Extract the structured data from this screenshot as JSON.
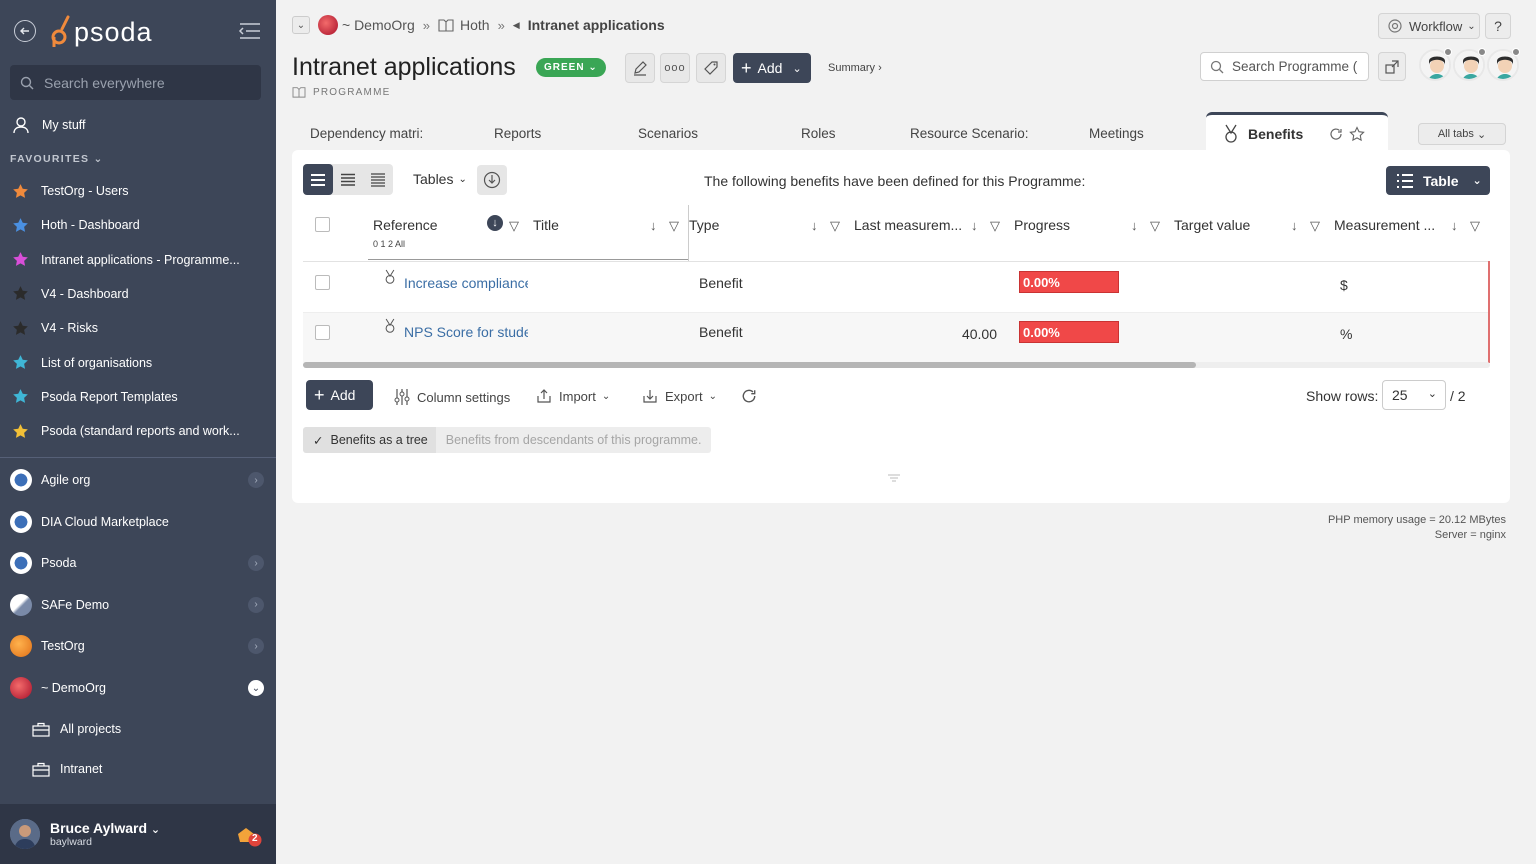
{
  "sidebar": {
    "logo": "psoda",
    "search_placeholder": "Search everywhere",
    "mystuff": "My stuff",
    "favourites_label": "FAVOURITES",
    "favourites": [
      {
        "label": "TestOrg - Users",
        "color": "#f08a3c"
      },
      {
        "label": "Hoth - Dashboard",
        "color": "#4a90e2"
      },
      {
        "label": "Intranet applications - Programme...",
        "color": "#d94fd9"
      },
      {
        "label": "V4 - Dashboard",
        "color": "#2b2b2b"
      },
      {
        "label": "V4 - Risks",
        "color": "#2b2b2b"
      },
      {
        "label": "List of organisations",
        "color": "#3fb6d6"
      },
      {
        "label": "Psoda Report Templates",
        "color": "#3fb6d6"
      },
      {
        "label": "Psoda (standard reports and work...",
        "color": "#f2c037"
      }
    ],
    "orgs": [
      {
        "label": "Agile org",
        "has_chevron": true
      },
      {
        "label": "DIA Cloud Marketplace",
        "has_chevron": false
      },
      {
        "label": "Psoda",
        "has_chevron": true
      },
      {
        "label": "SAFe Demo",
        "has_chevron": true
      },
      {
        "label": "TestOrg",
        "has_chevron": true
      },
      {
        "label": "~ DemoOrg",
        "has_chevron": true
      }
    ],
    "subitems": [
      {
        "label": "All projects"
      },
      {
        "label": "Intranet"
      }
    ],
    "user": {
      "name": "Bruce Aylward",
      "login": "baylward",
      "notifications": "2"
    }
  },
  "breadcrumb": {
    "org": "~ DemoOrg",
    "parent": "Hoth",
    "current": "Intranet applications"
  },
  "header": {
    "title": "Intranet applications",
    "status": "GREEN",
    "type_label": "PROGRAMME",
    "add_label": "Add",
    "summary_label": "Summary ›",
    "workflow_label": "Workflow",
    "help_label": "?",
    "search_placeholder": "Search Programme ("
  },
  "tabs": {
    "items": [
      "Dependency matri:",
      "Reports",
      "Scenarios",
      "Roles",
      "Resource Scenario:",
      "Meetings"
    ],
    "active": "Benefits",
    "all_tabs": "All tabs"
  },
  "panel": {
    "tables_label": "Tables",
    "intro": "The following benefits have been defined for this Programme:",
    "view_label": "Table",
    "columns": [
      {
        "label": "Reference",
        "sub": "0 1 2 All"
      },
      {
        "label": "Title"
      },
      {
        "label": "Type"
      },
      {
        "label": "Last measurem..."
      },
      {
        "label": "Progress"
      },
      {
        "label": "Target value"
      },
      {
        "label": "Measurement ..."
      }
    ],
    "rows": [
      {
        "title": "Increase compliance",
        "type": "Benefit",
        "last": "",
        "progress": "0.00%",
        "target": "",
        "measurement": "$"
      },
      {
        "title": "NPS Score for stude",
        "type": "Benefit",
        "last": "40.00",
        "progress": "0.00%",
        "target": "",
        "measurement": "%"
      }
    ],
    "add_label": "Add",
    "column_settings": "Column settings",
    "import": "Import",
    "export": "Export",
    "show_rows_label": "Show rows:",
    "rows_value": "25",
    "rows_total": "/ 2",
    "tree_on": "Benefits as a tree",
    "tree_off": "Benefits from descendants of this programme."
  },
  "footer": {
    "memory": "PHP memory usage = 20.12 MBytes",
    "server": "Server = nginx"
  }
}
